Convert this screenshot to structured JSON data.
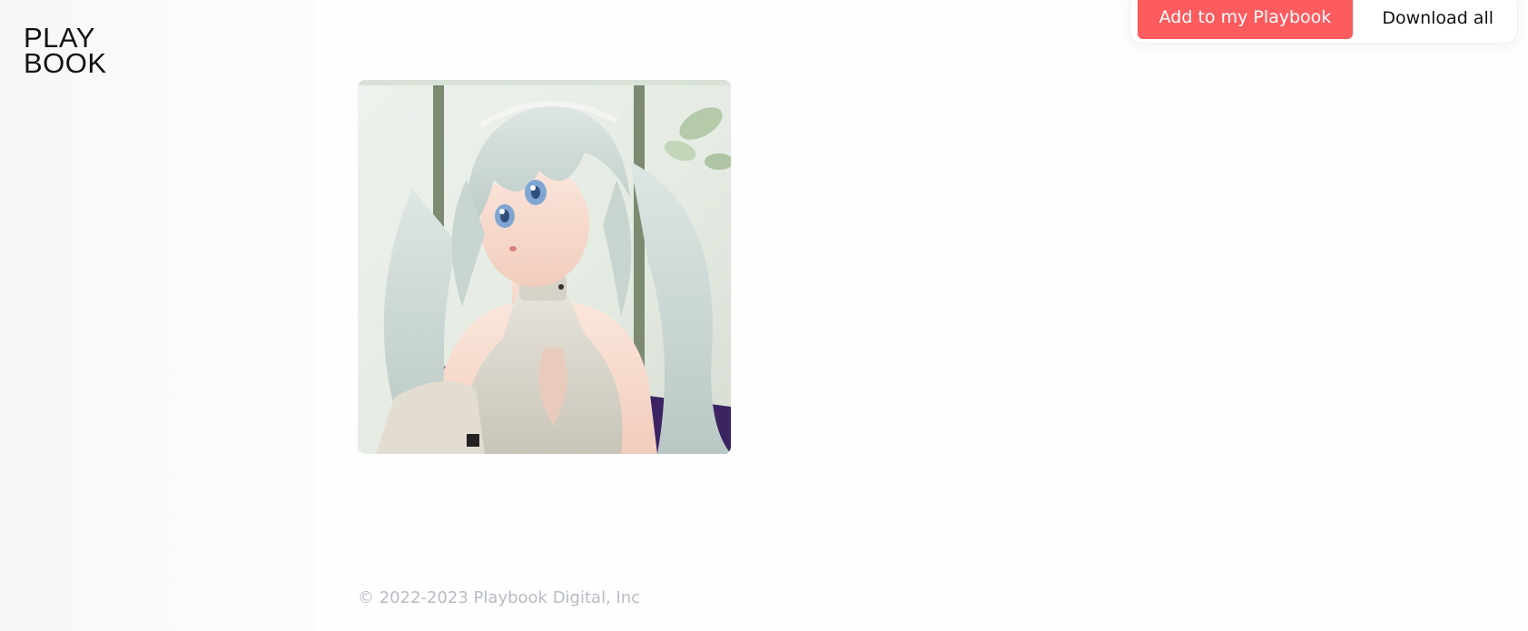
{
  "brand": {
    "logo_line1": "PLAY",
    "logo_line2": "BOOK"
  },
  "actions": {
    "add_label": "Add to my Playbook",
    "download_label": "Download all"
  },
  "footer": {
    "copyright": "© 2022-2023 Playbook Digital, Inc"
  },
  "colors": {
    "accent": "#fd5c5f",
    "footer_text": "#b8bcc4"
  },
  "icons": {
    "image": "anime-character-illustration"
  }
}
